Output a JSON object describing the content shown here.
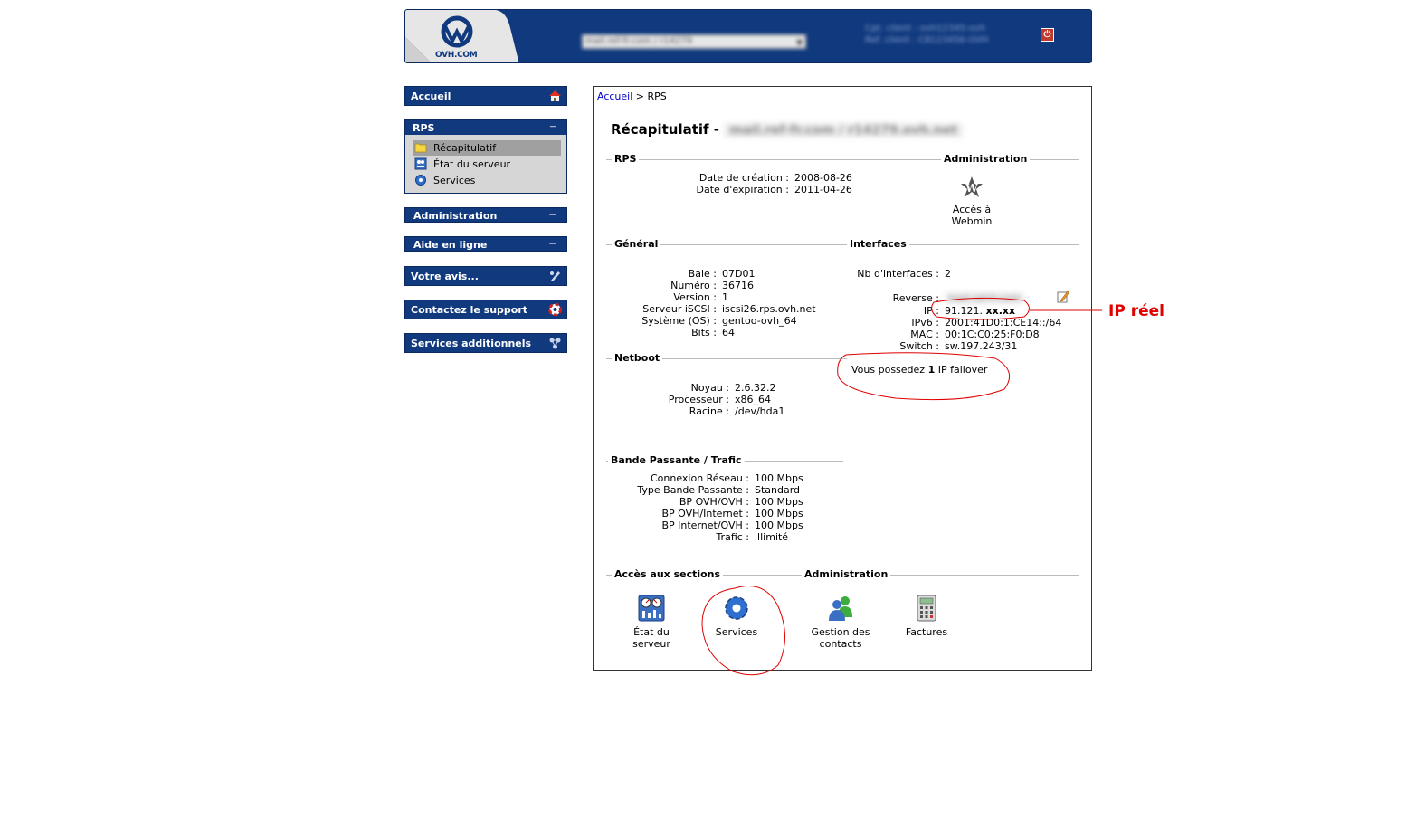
{
  "header": {
    "logo_text": "OVH.COM",
    "server_select_value": "mail.ref-fr.com / r14279",
    "client_line1": "Cpt. client : ovh12345-ovh",
    "client_line2": "Ref. client : C8123456-OVH",
    "power_label": "⏻"
  },
  "sidebar": {
    "accueil": "Accueil",
    "rps_title": "RPS",
    "rps_items": [
      {
        "label": "Récapitulatif",
        "icon": "folder-icon",
        "active": true
      },
      {
        "label": "État du serveur",
        "icon": "server-state-icon",
        "active": false
      },
      {
        "label": "Services",
        "icon": "gear-icon",
        "active": false
      }
    ],
    "administration": "Administration",
    "aide": "Aide en ligne",
    "avis": "Votre avis...",
    "contact": "Contactez le support",
    "services_add": "Services additionnels",
    "collapse_symbol": "−"
  },
  "main": {
    "breadcrumb_link": "Accueil",
    "breadcrumb_sep": ">",
    "breadcrumb_current": "RPS",
    "title": "Récapitulatif -",
    "title_blurred": "mail.ref-fr.com / r14279.ovh.net",
    "rps": {
      "title": "RPS",
      "rows": [
        {
          "k": "Date de création :",
          "v": "2008-08-26"
        },
        {
          "k": "Date d'expiration :",
          "v": "2011-04-26"
        }
      ]
    },
    "administration": {
      "title": "Administration",
      "webmin_line1": "Accès à",
      "webmin_line2": "Webmin"
    },
    "general": {
      "title": "Général",
      "rows": [
        {
          "k": "Baie :",
          "v": "07D01"
        },
        {
          "k": "Numéro :",
          "v": "36716"
        },
        {
          "k": "Version :",
          "v": "1"
        },
        {
          "k": "Serveur iSCSI :",
          "v": "iscsi26.rps.ovh.net"
        },
        {
          "k": "Système (OS) :",
          "v": "gentoo-ovh_64"
        },
        {
          "k": "Bits :",
          "v": "64"
        }
      ]
    },
    "interfaces": {
      "title": "Interfaces",
      "count_label": "Nb d'interfaces :",
      "count_value": "2",
      "reverse_label": "Reverse :",
      "reverse_value": "mail.ref-fr.com",
      "rows": [
        {
          "k": "IP :",
          "v": "91.121.",
          "v_bold": "xx.xx"
        },
        {
          "k": "IPv6 :",
          "v": "2001:41D0:1:CE14::/64"
        },
        {
          "k": "MAC :",
          "v": "00:1C:C0:25:F0:D8"
        },
        {
          "k": "Switch :",
          "v": "sw.197.243/31"
        }
      ],
      "failover_pre": "Vous possedez",
      "failover_count": "1",
      "failover_post": "IP failover"
    },
    "netboot": {
      "title": "Netboot",
      "rows": [
        {
          "k": "Noyau :",
          "v": "2.6.32.2"
        },
        {
          "k": "Processeur :",
          "v": "x86_64"
        },
        {
          "k": "Racine :",
          "v": "/dev/hda1"
        }
      ]
    },
    "bande": {
      "title": "Bande Passante / Trafic",
      "rows": [
        {
          "k": "Connexion Réseau :",
          "v": "100 Mbps"
        },
        {
          "k": "Type Bande Passante :",
          "v": "Standard"
        },
        {
          "k": "BP OVH/OVH :",
          "v": "100 Mbps"
        },
        {
          "k": "BP OVH/Internet :",
          "v": "100 Mbps"
        },
        {
          "k": "BP Internet/OVH :",
          "v": "100 Mbps"
        },
        {
          "k": "Trafic :",
          "v": "illimité"
        }
      ]
    },
    "acces": {
      "title": "Accès aux sections",
      "admin_title": "Administration",
      "tiles": [
        {
          "l1": "État du",
          "l2": "serveur"
        },
        {
          "l1": "Services",
          "l2": ""
        },
        {
          "l1": "Gestion des",
          "l2": "contacts"
        },
        {
          "l1": "Factures",
          "l2": ""
        }
      ]
    }
  },
  "annotation": {
    "ip_reel": "IP réel",
    "color": "#e00000"
  }
}
